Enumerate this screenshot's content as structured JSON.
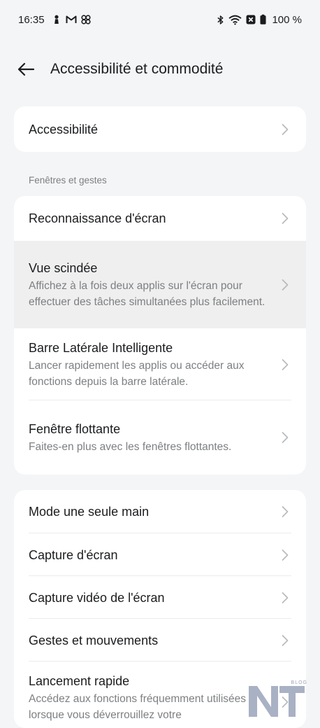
{
  "status_bar": {
    "time": "16:35",
    "battery": "100 %",
    "icons_left": [
      "person-icon",
      "gmail-icon",
      "pinwheel-icon"
    ],
    "icons_right": [
      "bluetooth-icon",
      "wifi-icon",
      "x-box-icon",
      "battery-icon"
    ]
  },
  "header": {
    "title": "Accessibilité et commodité"
  },
  "card1": {
    "items": [
      {
        "title": "Accessibilité"
      }
    ]
  },
  "section_windows": {
    "label": "Fenêtres et gestes"
  },
  "card2": {
    "items": [
      {
        "title": "Reconnaissance d'écran"
      },
      {
        "title": "Vue scindée",
        "subtitle": "Affichez à la fois deux applis sur l'écran pour effectuer des tâches simultanées plus facilement."
      },
      {
        "title": "Barre Latérale Intelligente",
        "subtitle": "Lancer rapidement les applis ou accéder aux fonctions depuis la barre latérale."
      },
      {
        "title": "Fenêtre flottante",
        "subtitle": "Faites-en plus avec les fenêtres flottantes."
      }
    ]
  },
  "card3": {
    "items": [
      {
        "title": "Mode une seule main"
      },
      {
        "title": "Capture d'écran"
      },
      {
        "title": "Capture vidéo de l'écran"
      },
      {
        "title": "Gestes et mouvements"
      },
      {
        "title": "Lancement rapide",
        "subtitle": "Accédez aux fonctions fréquemment utilisées lorsque vous déverrouillez votre"
      }
    ]
  },
  "watermark": {
    "letters": "NT",
    "tag": "BLOG"
  },
  "colors": {
    "background": "#f4f5f7",
    "card": "#ffffff",
    "highlight": "#efefef",
    "subtitle": "#7d7f82",
    "chevron": "#b9bbbe",
    "watermark": "#9aa3ba"
  }
}
